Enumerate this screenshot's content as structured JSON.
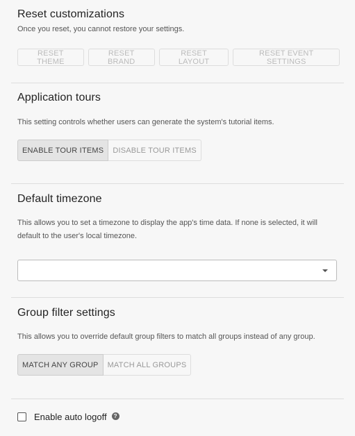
{
  "reset": {
    "title": "Reset customizations",
    "description": "Once you reset, you cannot restore your settings.",
    "buttons": [
      "Reset theme",
      "Reset brand",
      "Reset layout",
      "Reset event settings"
    ]
  },
  "tours": {
    "title": "Application tours",
    "description": "This setting controls whether users can generate the system's tutorial items.",
    "options": [
      "Enable tour items",
      "Disable tour items"
    ],
    "selected": "Enable tour items"
  },
  "timezone": {
    "title": "Default timezone",
    "description": "This allows you to set a timezone to display the app's time data. If none is selected, it will default to the user's local timezone.",
    "value": ""
  },
  "group_filter": {
    "title": "Group filter settings",
    "description": "This allows you to override default group filters to match all groups instead of any group.",
    "options": [
      "Match any group",
      "Match all groups"
    ],
    "selected": "Match any group"
  },
  "auto_logoff": {
    "label": "Enable auto logoff",
    "checked": false,
    "help_icon": "question-circle-icon"
  }
}
